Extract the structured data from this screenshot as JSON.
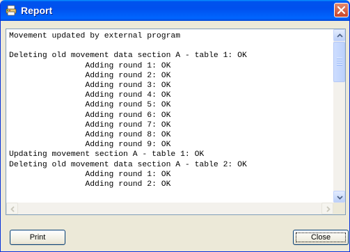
{
  "window": {
    "title": "Report"
  },
  "report_lines": [
    "Movement updated by external program",
    "",
    "Deleting old movement data section A - table 1: OK",
    "                Adding round 1: OK",
    "                Adding round 2: OK",
    "                Adding round 3: OK",
    "                Adding round 4: OK",
    "                Adding round 5: OK",
    "                Adding round 6: OK",
    "                Adding round 7: OK",
    "                Adding round 8: OK",
    "                Adding round 9: OK",
    "Updating movement section A - table 1: OK",
    "Deleting old movement data section A - table 2: OK",
    "                Adding round 1: OK",
    "                Adding round 2: OK"
  ],
  "buttons": {
    "print_label": "Print",
    "close_label": "Close"
  },
  "icons": {
    "app": "report-printer-icon",
    "close": "close-icon",
    "scroll_up": "arrow-up-icon",
    "scroll_down": "arrow-down-icon",
    "scroll_left": "arrow-left-icon",
    "scroll_right": "arrow-right-icon"
  },
  "colors": {
    "titlebar": "#0053ee",
    "close_button": "#c8452b",
    "background": "#ece9d8",
    "textbox_border": "#7f9db9"
  }
}
